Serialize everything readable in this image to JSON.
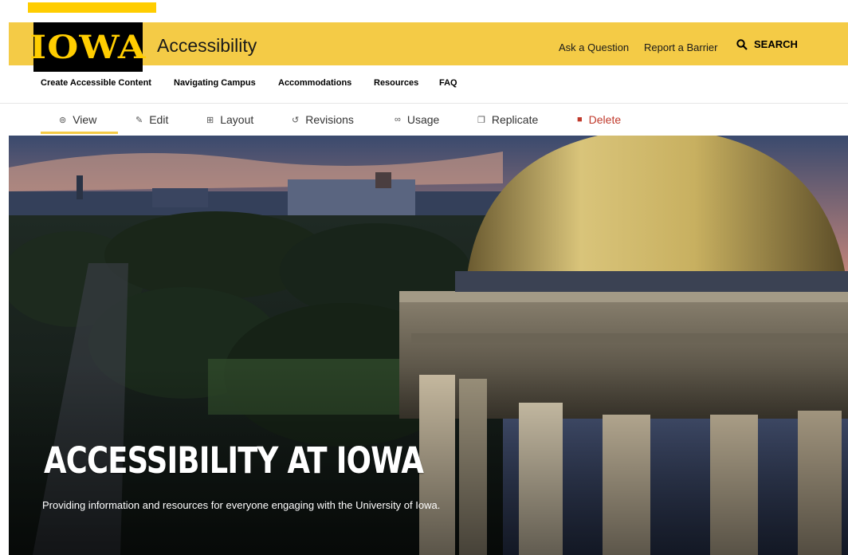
{
  "header": {
    "logo": "IOWA",
    "site_title": "Accessibility",
    "utility_links": [
      "Ask a Question",
      "Report a Barrier"
    ],
    "search_label": "SEARCH"
  },
  "main_nav": [
    "Create Accessible Content",
    "Navigating Campus",
    "Accommodations",
    "Resources",
    "FAQ"
  ],
  "edit_tabs": [
    {
      "label": "View",
      "icon": "eye-icon",
      "active": true
    },
    {
      "label": "Edit",
      "icon": "pencil-icon"
    },
    {
      "label": "Layout",
      "icon": "grid-icon"
    },
    {
      "label": "Revisions",
      "icon": "history-icon"
    },
    {
      "label": "Usage",
      "icon": "link-icon"
    },
    {
      "label": "Replicate",
      "icon": "copy-icon"
    },
    {
      "label": "Delete",
      "icon": "trash-icon"
    }
  ],
  "hero": {
    "title": "ACCESSIBILITY AT IOWA",
    "subtitle": "Providing information and resources for everyone engaging with the University of Iowa."
  },
  "colors": {
    "brand_gold": "#FFCD00",
    "header_bg": "#F4CB46",
    "delete_red": "#c0392b"
  }
}
